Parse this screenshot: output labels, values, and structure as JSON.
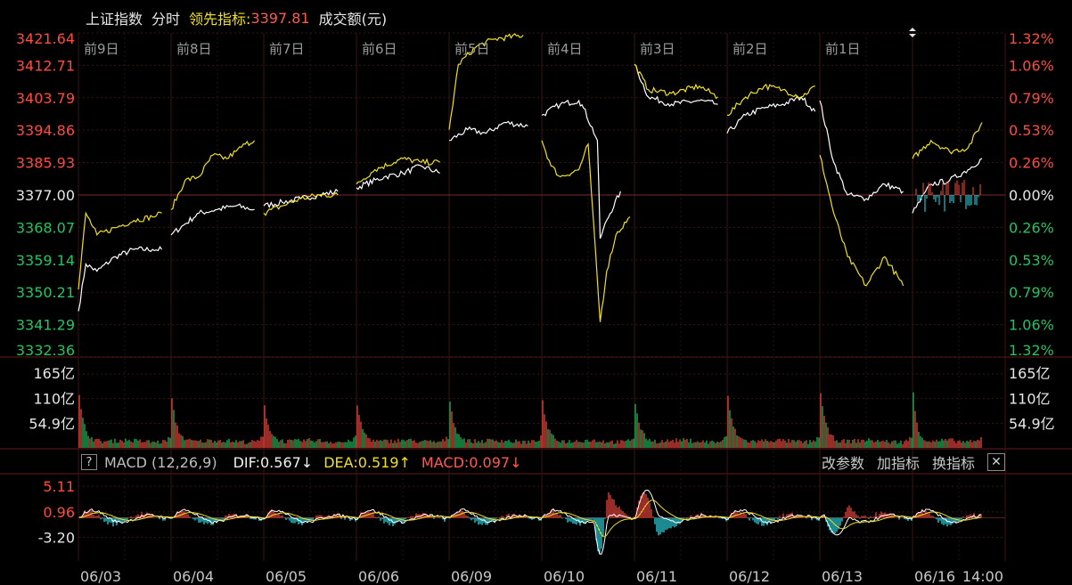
{
  "header": {
    "index_name": "上证指数",
    "mode": "分时",
    "lead_label": "领先指标:",
    "lead_value": "3397.81",
    "volume_label": "成交额(元)"
  },
  "colors": {
    "up": "#ff4b3f",
    "down": "#22c55e",
    "price": "#ffffff",
    "lead": "#f0e020",
    "macd_neg": "#2ee6f0",
    "grid": "#4a1a1a"
  },
  "chart_data": [
    {
      "type": "line",
      "name": "price",
      "title": "",
      "day_labels": [
        "前9日",
        "前8日",
        "前7日",
        "前6日",
        "前5日",
        "前4日",
        "前3日",
        "前2日",
        "前1日",
        ""
      ],
      "dates": [
        "06/03",
        "06/04",
        "06/05",
        "06/06",
        "06/09",
        "06/10",
        "06/11",
        "06/12",
        "06/13",
        "06/16"
      ],
      "end_time": "14:00",
      "y_ticks": [
        "3421.64",
        "3412.71",
        "3403.79",
        "3394.86",
        "3385.93",
        "3377.00",
        "3368.07",
        "3359.14",
        "3350.21",
        "3341.29",
        "3332.36"
      ],
      "pct_ticks": [
        "1.32%",
        "1.06%",
        "0.79%",
        "0.53%",
        "0.26%",
        "0.00%",
        "0.26%",
        "0.53%",
        "0.79%",
        "1.06%",
        "1.32%"
      ],
      "ylim": [
        3332.36,
        3421.64
      ],
      "base": 3377.0,
      "series": [
        {
          "key": "index",
          "points": [
            [
              0,
              3345
            ],
            [
              0.08,
              3358
            ],
            [
              0.2,
              3356
            ],
            [
              0.4,
              3360
            ],
            [
              0.6,
              3362
            ],
            [
              0.8,
              3362
            ],
            [
              0.9,
              3362
            ],
            [
              1.0,
              3366
            ],
            [
              1.15,
              3369
            ],
            [
              1.3,
              3372
            ],
            [
              1.5,
              3373
            ],
            [
              1.7,
              3374
            ],
            [
              1.9,
              3373
            ],
            [
              2.0,
              3374
            ],
            [
              2.2,
              3375
            ],
            [
              2.4,
              3376
            ],
            [
              2.6,
              3377
            ],
            [
              2.8,
              3378
            ],
            [
              3.0,
              3379
            ],
            [
              3.3,
              3382
            ],
            [
              3.5,
              3383
            ],
            [
              3.7,
              3385
            ],
            [
              3.9,
              3383
            ],
            [
              4.0,
              3392
            ],
            [
              4.2,
              3395
            ],
            [
              4.4,
              3394
            ],
            [
              4.6,
              3397
            ],
            [
              4.85,
              3396
            ],
            [
              5.0,
              3399
            ],
            [
              5.2,
              3402
            ],
            [
              5.4,
              3403
            ],
            [
              5.45,
              3401
            ],
            [
              5.6,
              3392
            ],
            [
              5.63,
              3365
            ],
            [
              5.7,
              3370
            ],
            [
              5.85,
              3378
            ],
            [
              6.0,
              3413
            ],
            [
              6.15,
              3404
            ],
            [
              6.4,
              3402
            ],
            [
              6.7,
              3403
            ],
            [
              6.9,
              3402
            ],
            [
              7.0,
              3394
            ],
            [
              7.2,
              3399
            ],
            [
              7.4,
              3401
            ],
            [
              7.6,
              3402
            ],
            [
              7.8,
              3404
            ],
            [
              7.95,
              3400
            ],
            [
              8.0,
              3403
            ],
            [
              8.15,
              3386
            ],
            [
              8.3,
              3377
            ],
            [
              8.5,
              3376
            ],
            [
              8.7,
              3380
            ],
            [
              8.9,
              3378
            ],
            [
              9.0,
              3372
            ],
            [
              9.2,
              3380
            ],
            [
              9.4,
              3381
            ],
            [
              9.6,
              3384
            ],
            [
              9.75,
              3387
            ]
          ]
        },
        {
          "key": "lead",
          "points": [
            [
              0,
              3351
            ],
            [
              0.08,
              3372
            ],
            [
              0.2,
              3366
            ],
            [
              0.4,
              3368
            ],
            [
              0.6,
              3370
            ],
            [
              0.8,
              3371
            ],
            [
              0.9,
              3372
            ],
            [
              1.0,
              3373
            ],
            [
              1.15,
              3381
            ],
            [
              1.3,
              3382
            ],
            [
              1.45,
              3388
            ],
            [
              1.6,
              3387
            ],
            [
              1.7,
              3389
            ],
            [
              1.8,
              3391
            ],
            [
              1.9,
              3392
            ],
            [
              2.0,
              3372
            ],
            [
              2.2,
              3374
            ],
            [
              2.4,
              3376
            ],
            [
              2.6,
              3377
            ],
            [
              2.8,
              3377
            ],
            [
              3.0,
              3380
            ],
            [
              3.2,
              3384
            ],
            [
              3.5,
              3387
            ],
            [
              3.7,
              3386
            ],
            [
              3.9,
              3386
            ],
            [
              4.0,
              3395
            ],
            [
              4.1,
              3413
            ],
            [
              4.3,
              3418
            ],
            [
              4.5,
              3420
            ],
            [
              4.8,
              3421
            ],
            [
              5.0,
              3392
            ],
            [
              5.1,
              3385
            ],
            [
              5.2,
              3382
            ],
            [
              5.4,
              3384
            ],
            [
              5.5,
              3391
            ],
            [
              5.63,
              3342
            ],
            [
              5.7,
              3356
            ],
            [
              5.8,
              3366
            ],
            [
              5.95,
              3371
            ],
            [
              6.0,
              3413
            ],
            [
              6.15,
              3406
            ],
            [
              6.4,
              3405
            ],
            [
              6.7,
              3407
            ],
            [
              6.9,
              3404
            ],
            [
              7.0,
              3399
            ],
            [
              7.2,
              3404
            ],
            [
              7.4,
              3407
            ],
            [
              7.6,
              3406
            ],
            [
              7.8,
              3404
            ],
            [
              7.95,
              3407
            ],
            [
              8.0,
              3388
            ],
            [
              8.15,
              3372
            ],
            [
              8.3,
              3360
            ],
            [
              8.5,
              3352
            ],
            [
              8.7,
              3360
            ],
            [
              8.9,
              3352
            ],
            [
              9.0,
              3387
            ],
            [
              9.2,
              3392
            ],
            [
              9.4,
              3389
            ],
            [
              9.6,
              3390
            ],
            [
              9.75,
              3397
            ]
          ]
        }
      ]
    },
    {
      "type": "bar",
      "name": "volume",
      "y_ticks": [
        "165亿",
        "110亿",
        "54.9亿"
      ],
      "ylim": [
        0,
        165
      ],
      "session_open_values": [
        110,
        103,
        88,
        92,
        102,
        98,
        95,
        110,
        121,
        118
      ],
      "session_base_value": 8
    },
    {
      "type": "line",
      "name": "macd",
      "label": "MACD (12,26,9)",
      "dif": "DIF:0.567↓",
      "dea": "DEA:0.519↑",
      "macd": "MACD:0.097↓",
      "y_ticks": [
        "5.11",
        "0.96",
        "-3.20"
      ],
      "ylim": [
        -7.0,
        7.0
      ],
      "buttons": [
        "改参数",
        "加指标",
        "换指标"
      ],
      "close": "✕",
      "help": "?"
    }
  ]
}
